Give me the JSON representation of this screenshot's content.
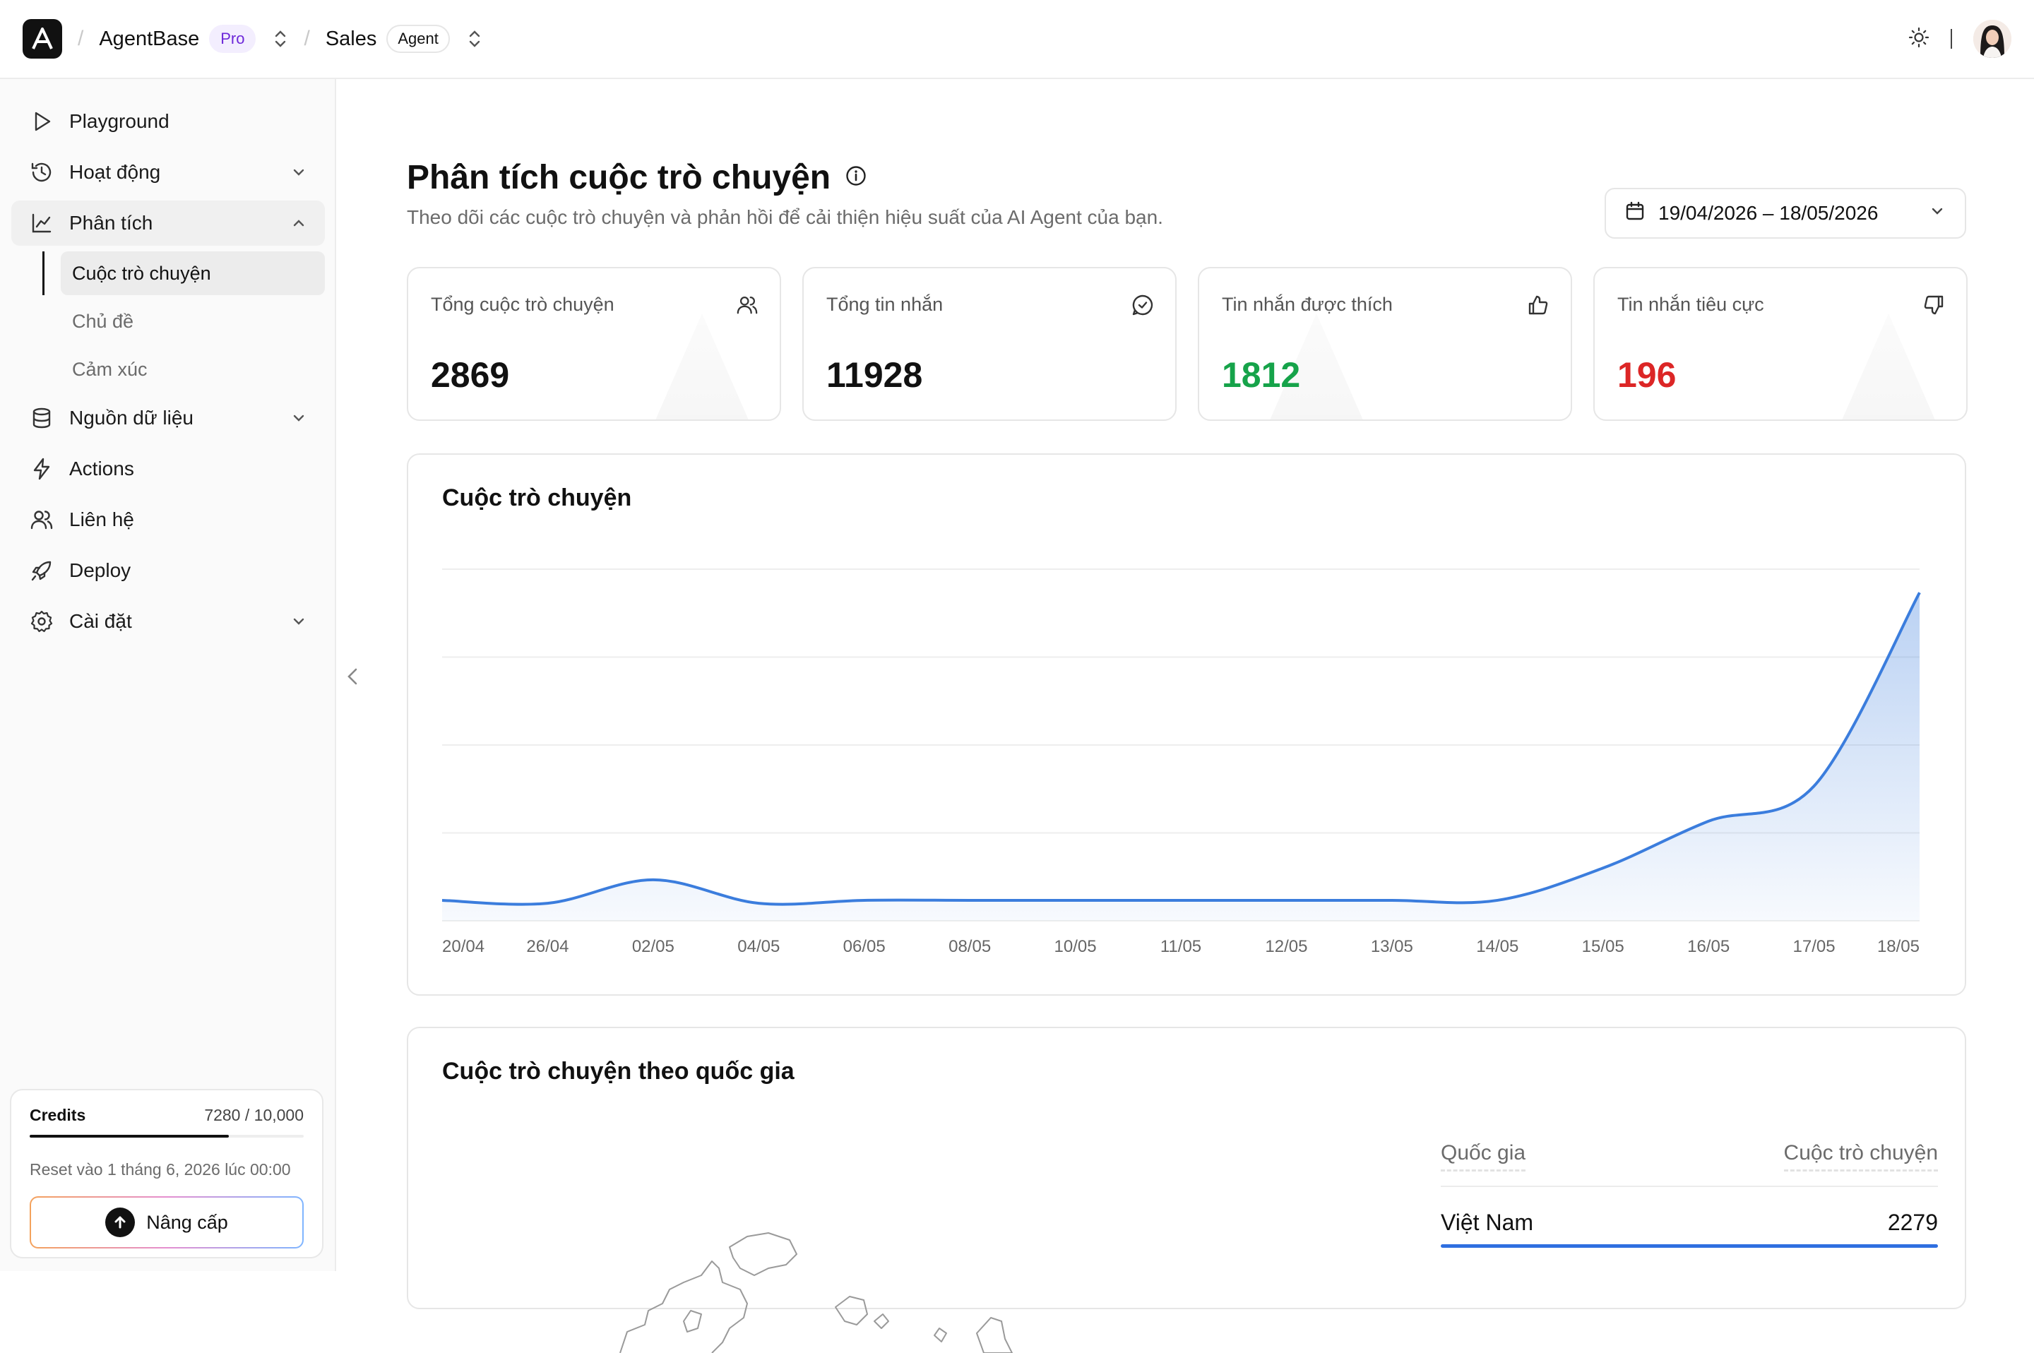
{
  "topbar": {
    "workspace": "AgentBase",
    "plan_badge": "Pro",
    "project": "Sales",
    "project_badge": "Agent"
  },
  "sidebar": {
    "items": [
      {
        "label": "Playground",
        "icon": "play-icon"
      },
      {
        "label": "Hoạt động",
        "icon": "history-icon"
      },
      {
        "label": "Phân tích",
        "icon": "chart-line-icon"
      },
      {
        "label": "Nguồn dữ liệu",
        "icon": "database-icon"
      },
      {
        "label": "Actions",
        "icon": "bolt-icon"
      },
      {
        "label": "Liên hệ",
        "icon": "users-icon"
      },
      {
        "label": "Deploy",
        "icon": "rocket-icon"
      },
      {
        "label": "Cài đặt",
        "icon": "gear-icon"
      }
    ],
    "sub_items": [
      "Cuộc trò chuyện",
      "Chủ đề",
      "Cảm xúc"
    ],
    "credits": {
      "title": "Credits",
      "used_text": "7280 / 10,000",
      "used": 7280,
      "total": 10000,
      "reset": "Reset vào 1 tháng 6, 2026 lúc 00:00",
      "upgrade_label": "Nâng cấp"
    }
  },
  "page": {
    "title": "Phân tích cuộc trò chuyện",
    "subtitle": "Theo dõi các cuộc trò chuyện và phản hồi để cải thiện hiệu suất của AI Agent của bạn.",
    "date_range": "19/04/2026 – 18/05/2026"
  },
  "stats": [
    {
      "label": "Tổng cuộc trò chuyện",
      "value": "2869",
      "icon": "users-icon"
    },
    {
      "label": "Tổng tin nhắn",
      "value": "11928",
      "icon": "message-circle-icon"
    },
    {
      "label": "Tin nhắn được thích",
      "value": "1812",
      "icon": "thumbs-up-icon"
    },
    {
      "label": "Tin nhắn tiêu cực",
      "value": "196",
      "icon": "thumbs-down-icon"
    }
  ],
  "chart_card": {
    "title": "Cuộc trò chuyện"
  },
  "chart_data": {
    "type": "area",
    "title": "Cuộc trò chuyện",
    "categories": [
      "20/04",
      "26/04",
      "02/05",
      "04/05",
      "06/05",
      "08/05",
      "10/05",
      "11/05",
      "12/05",
      "13/05",
      "14/05",
      "15/05",
      "16/05",
      "17/05",
      "18/05"
    ],
    "values": [
      35,
      30,
      70,
      30,
      35,
      35,
      35,
      35,
      35,
      35,
      35,
      90,
      170,
      230,
      560
    ],
    "ylim": [
      0,
      600
    ],
    "grid": true,
    "color": "#3b7ddd"
  },
  "geo_card": {
    "title": "Cuộc trò chuyện theo quốc gia",
    "col_country": "Quốc gia",
    "col_count": "Cuộc trò chuyện",
    "rows": [
      {
        "country": "Việt Nam",
        "count": "2279"
      }
    ]
  }
}
